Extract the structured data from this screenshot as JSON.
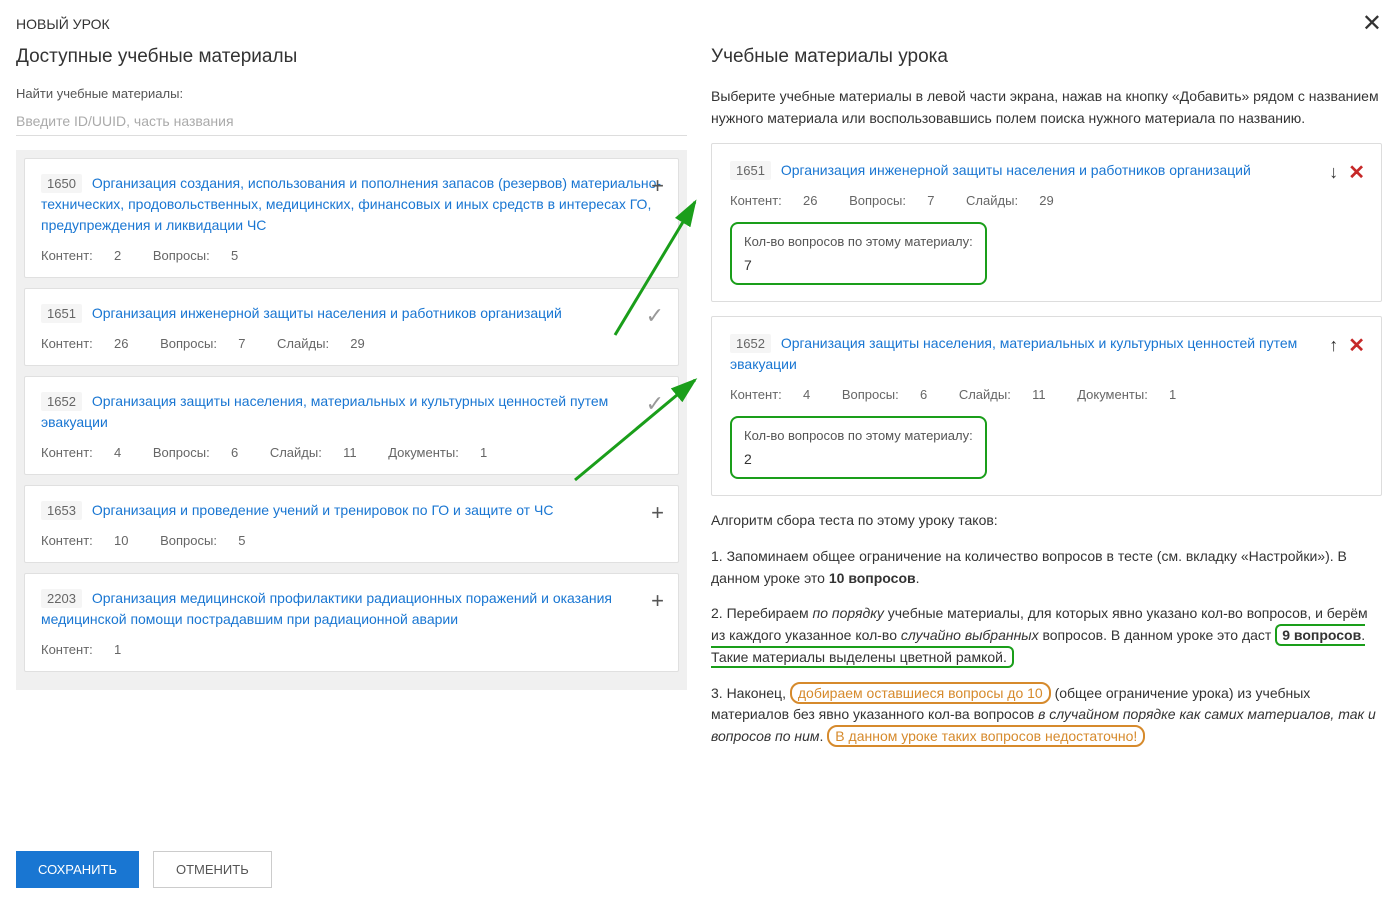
{
  "header": {
    "title": "НОВЫЙ УРОК"
  },
  "left": {
    "sectionTitle": "Доступные учебные материалы",
    "searchLabel": "Найти учебные материалы:",
    "searchPlaceholder": "Введите ID/UUID, часть названия",
    "items": [
      {
        "id": "1650",
        "title": "Организация создания, использования и пополнения запасов (резервов) материально-технических, продовольственных, медицинских, финансовых и иных средств в интересах ГО, предупреждения и ликвидации ЧС",
        "content": "2",
        "questions": "5",
        "slides": null,
        "docs": null,
        "action": "add"
      },
      {
        "id": "1651",
        "title": "Организация инженерной защиты населения и работников организаций",
        "content": "26",
        "questions": "7",
        "slides": "29",
        "docs": null,
        "action": "check"
      },
      {
        "id": "1652",
        "title": "Организация защиты населения, материальных и культурных ценностей путем эвакуации",
        "content": "4",
        "questions": "6",
        "slides": "11",
        "docs": "1",
        "action": "check"
      },
      {
        "id": "1653",
        "title": "Организация и проведение учений и тренировок по ГО и защите от ЧС",
        "content": "10",
        "questions": "5",
        "slides": null,
        "docs": null,
        "action": "add"
      },
      {
        "id": "2203",
        "title": "Организация медицинской профилактики радиационных поражений и оказания медицинской помощи пострадавшим при радиационной аварии",
        "content": "1",
        "questions": null,
        "slides": null,
        "docs": null,
        "action": "add"
      }
    ]
  },
  "right": {
    "sectionTitle": "Учебные материалы урока",
    "intro": "Выберите учебные материалы в левой части экрана, нажав на кнопку «Добавить» рядом с названием нужного материала или воспользовавшись полем поиска нужного материала по названию.",
    "items": [
      {
        "id": "1651",
        "title": "Организация инженерной защиты населения и работников организаций",
        "content": "26",
        "questions": "7",
        "slides": "29",
        "docs": null,
        "qLabel": "Кол-во вопросов по этому материалу:",
        "qVal": "7",
        "arrow": "down"
      },
      {
        "id": "1652",
        "title": "Организация защиты населения, материальных и культурных ценностей путем эвакуации",
        "content": "4",
        "questions": "6",
        "slides": "11",
        "docs": "1",
        "qLabel": "Кол-во вопросов по этому материалу:",
        "qVal": "2",
        "arrow": "up"
      }
    ],
    "algoTitle": "Алгоритм сбора теста по этому уроку таков:",
    "step1a": "1. Запоминаем общее ограничение на количество вопросов в тесте (см. вкладку «Настройки»). В данном уроке это ",
    "step1b": "10 вопросов",
    "step1c": ".",
    "step2a": "2. Перебираем ",
    "step2b": "по порядку",
    "step2c": " учебные материалы, для которых явно указано кол-во вопросов, и берём из каждого указанное кол-во ",
    "step2d": "случайно выбранных",
    "step2e": " вопросов. В данном уроке это даст ",
    "step2f": "9 вопросов",
    "step2g": ". Такие материалы выделены цветной рамкой.",
    "step3a": "3. Наконец, ",
    "step3b": "добираем оставшиеся вопросы до 10",
    "step3c": " (общее ограничение урока) из учебных материалов без явно указанного кол-ва вопросов ",
    "step3d": "в случайном порядке как самих материалов, так и вопросов по ним",
    "step3e": ". ",
    "step3f": "В данном уроке таких вопросов недостаточно!"
  },
  "labels": {
    "content": "Контент:",
    "questions": "Вопросы:",
    "slides": "Слайды:",
    "docs": "Документы:"
  },
  "footer": {
    "save": "СОХРАНИТЬ",
    "cancel": "ОТМЕНИТЬ"
  }
}
